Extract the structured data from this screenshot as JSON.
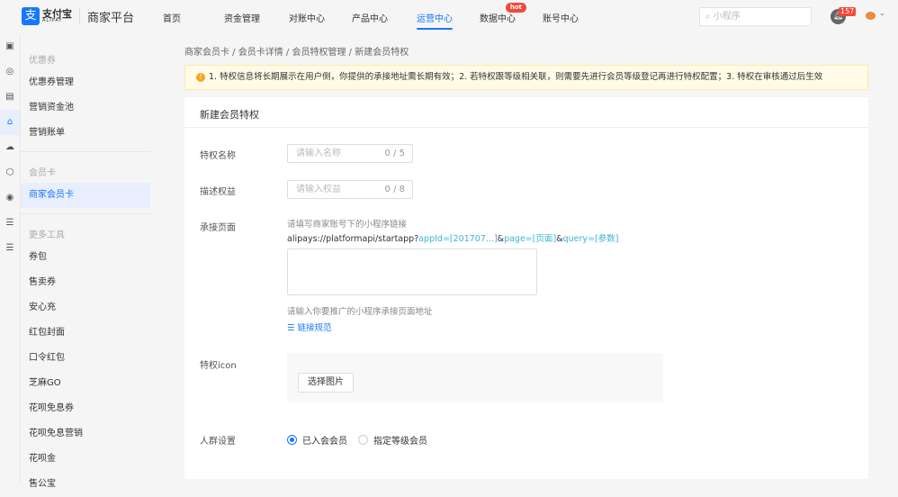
{
  "header": {
    "logo_mark": "支",
    "logo_text": "支付宝",
    "logo_sub": "ALIPAY",
    "platform": "商家平台",
    "nav": [
      "首页",
      "资金管理",
      "对账中心",
      "产品中心",
      "运营中心",
      "数据中心",
      "账号中心"
    ],
    "active_nav": 4,
    "hot_label": "hot",
    "search_placeholder": "小程序",
    "notification_count": "157"
  },
  "rail_icons": [
    "dashboard-icon",
    "coin-icon",
    "bill-icon",
    "gift-icon",
    "cloud-icon",
    "box-icon",
    "target-icon",
    "doc-icon",
    "doc2-icon"
  ],
  "sidebar": {
    "groups": [
      {
        "title": "优惠券",
        "items": [
          "优惠券管理",
          "营销资金池",
          "营销账单"
        ]
      },
      {
        "title": "会员卡",
        "items": [
          "商家会员卡"
        ]
      },
      {
        "title": "更多工具",
        "items": [
          "券包",
          "售卖券",
          "安心充",
          "红包封面",
          "口令红包",
          "芝麻GO",
          "花呗免息券",
          "花呗免息营销",
          "花呗金",
          "售公宝"
        ]
      }
    ],
    "selected": "商家会员卡"
  },
  "breadcrumb": [
    "商家会员卡",
    "会员卡详情",
    "会员特权管理",
    "新建会员特权"
  ],
  "alert": "1. 特权信息将长期展示在用户侧，你提供的承接地址需长期有效；2. 若特权跟等级相关联，则需要先进行会员等级登记再进行特权配置；3. 特权在审核通过后生效",
  "form": {
    "title": "新建会员特权",
    "name": {
      "label": "特权名称",
      "placeholder": "请输入名称",
      "count": "0 / 5"
    },
    "desc": {
      "label": "描述权益",
      "placeholder": "请输入权益",
      "count": "0 / 8"
    },
    "page": {
      "label": "承接页面",
      "hint": "请填写商家账号下的小程序链接",
      "url_prefix": "alipays://platformapi/startapp?",
      "url_appid": "appId=[201707...]",
      "amp1": "&",
      "url_page": "page=[页面]",
      "amp2": "&",
      "url_query": "query=[参数]",
      "help": "请输入你要推广的小程序承接页面地址",
      "link": "链接规范"
    },
    "icon": {
      "label": "特权icon",
      "button": "选择图片"
    },
    "crowd": {
      "label": "人群设置",
      "options": [
        "已入会会员",
        "指定等级会员"
      ],
      "selected": 0
    }
  }
}
